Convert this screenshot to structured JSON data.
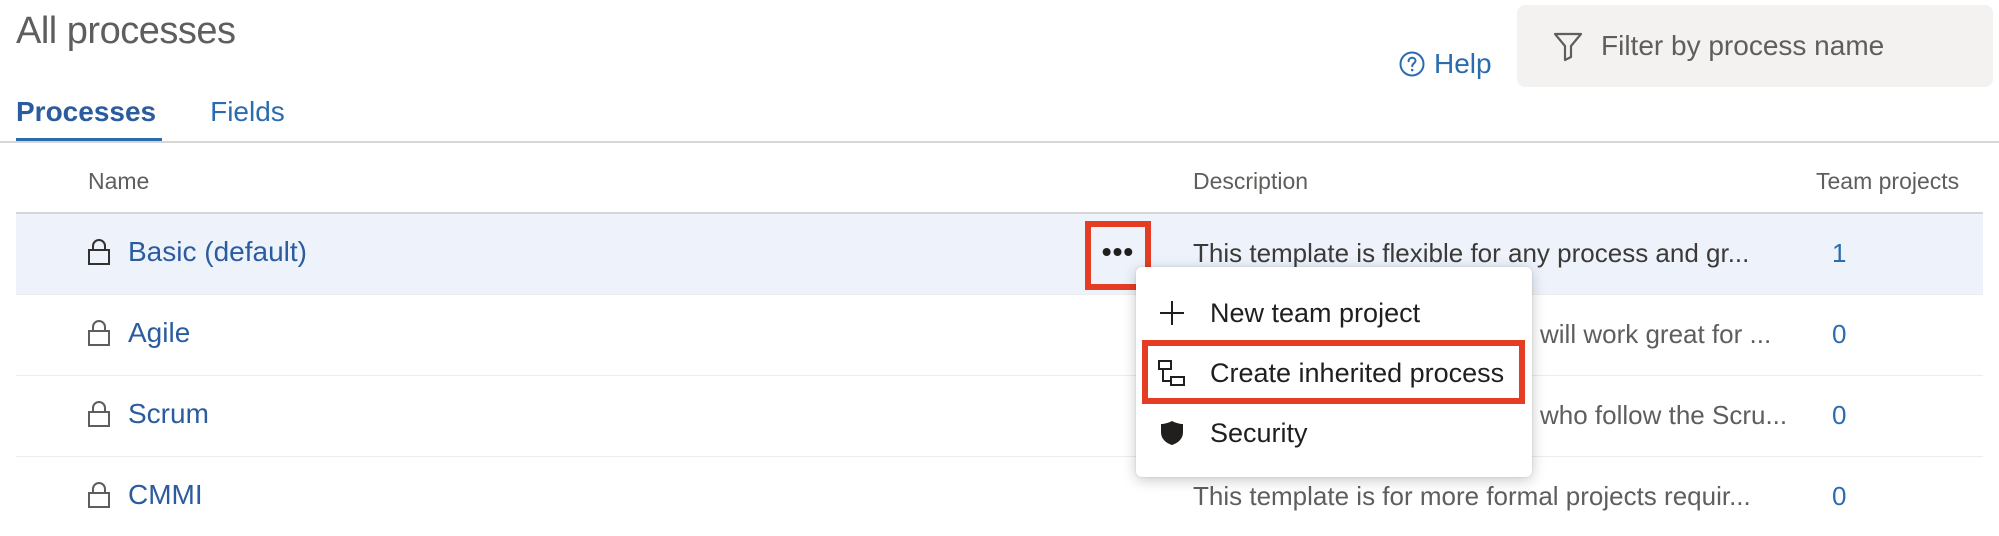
{
  "header": {
    "title": "All processes",
    "help_label": "Help",
    "filter_placeholder": "Filter by process name"
  },
  "tabs": [
    {
      "label": "Processes",
      "active": true
    },
    {
      "label": "Fields",
      "active": false
    }
  ],
  "table": {
    "columns": {
      "name": "Name",
      "description": "Description",
      "team_projects": "Team projects"
    },
    "rows": [
      {
        "name": "Basic (default)",
        "description": "This template is flexible for any process and gr...",
        "team_projects": "1",
        "selected": true
      },
      {
        "name": "Agile",
        "description": "will work great for ...",
        "team_projects": "0"
      },
      {
        "name": "Scrum",
        "description": "who follow the Scru...",
        "team_projects": "0"
      },
      {
        "name": "CMMI",
        "description": "This template is for more formal projects requir...",
        "team_projects": "0"
      }
    ]
  },
  "more_button": {
    "icon": "ellipsis-icon",
    "label": "•••"
  },
  "context_menu": {
    "items": [
      {
        "label": "New team project",
        "icon": "plus-icon"
      },
      {
        "label": "Create inherited process",
        "icon": "inherit-process-icon",
        "highlighted": true
      },
      {
        "label": "Security",
        "icon": "shield-icon"
      }
    ]
  },
  "colors": {
    "link": "#2b6cb0",
    "highlight": "#e53d24",
    "selected_row": "#eef3fb"
  }
}
